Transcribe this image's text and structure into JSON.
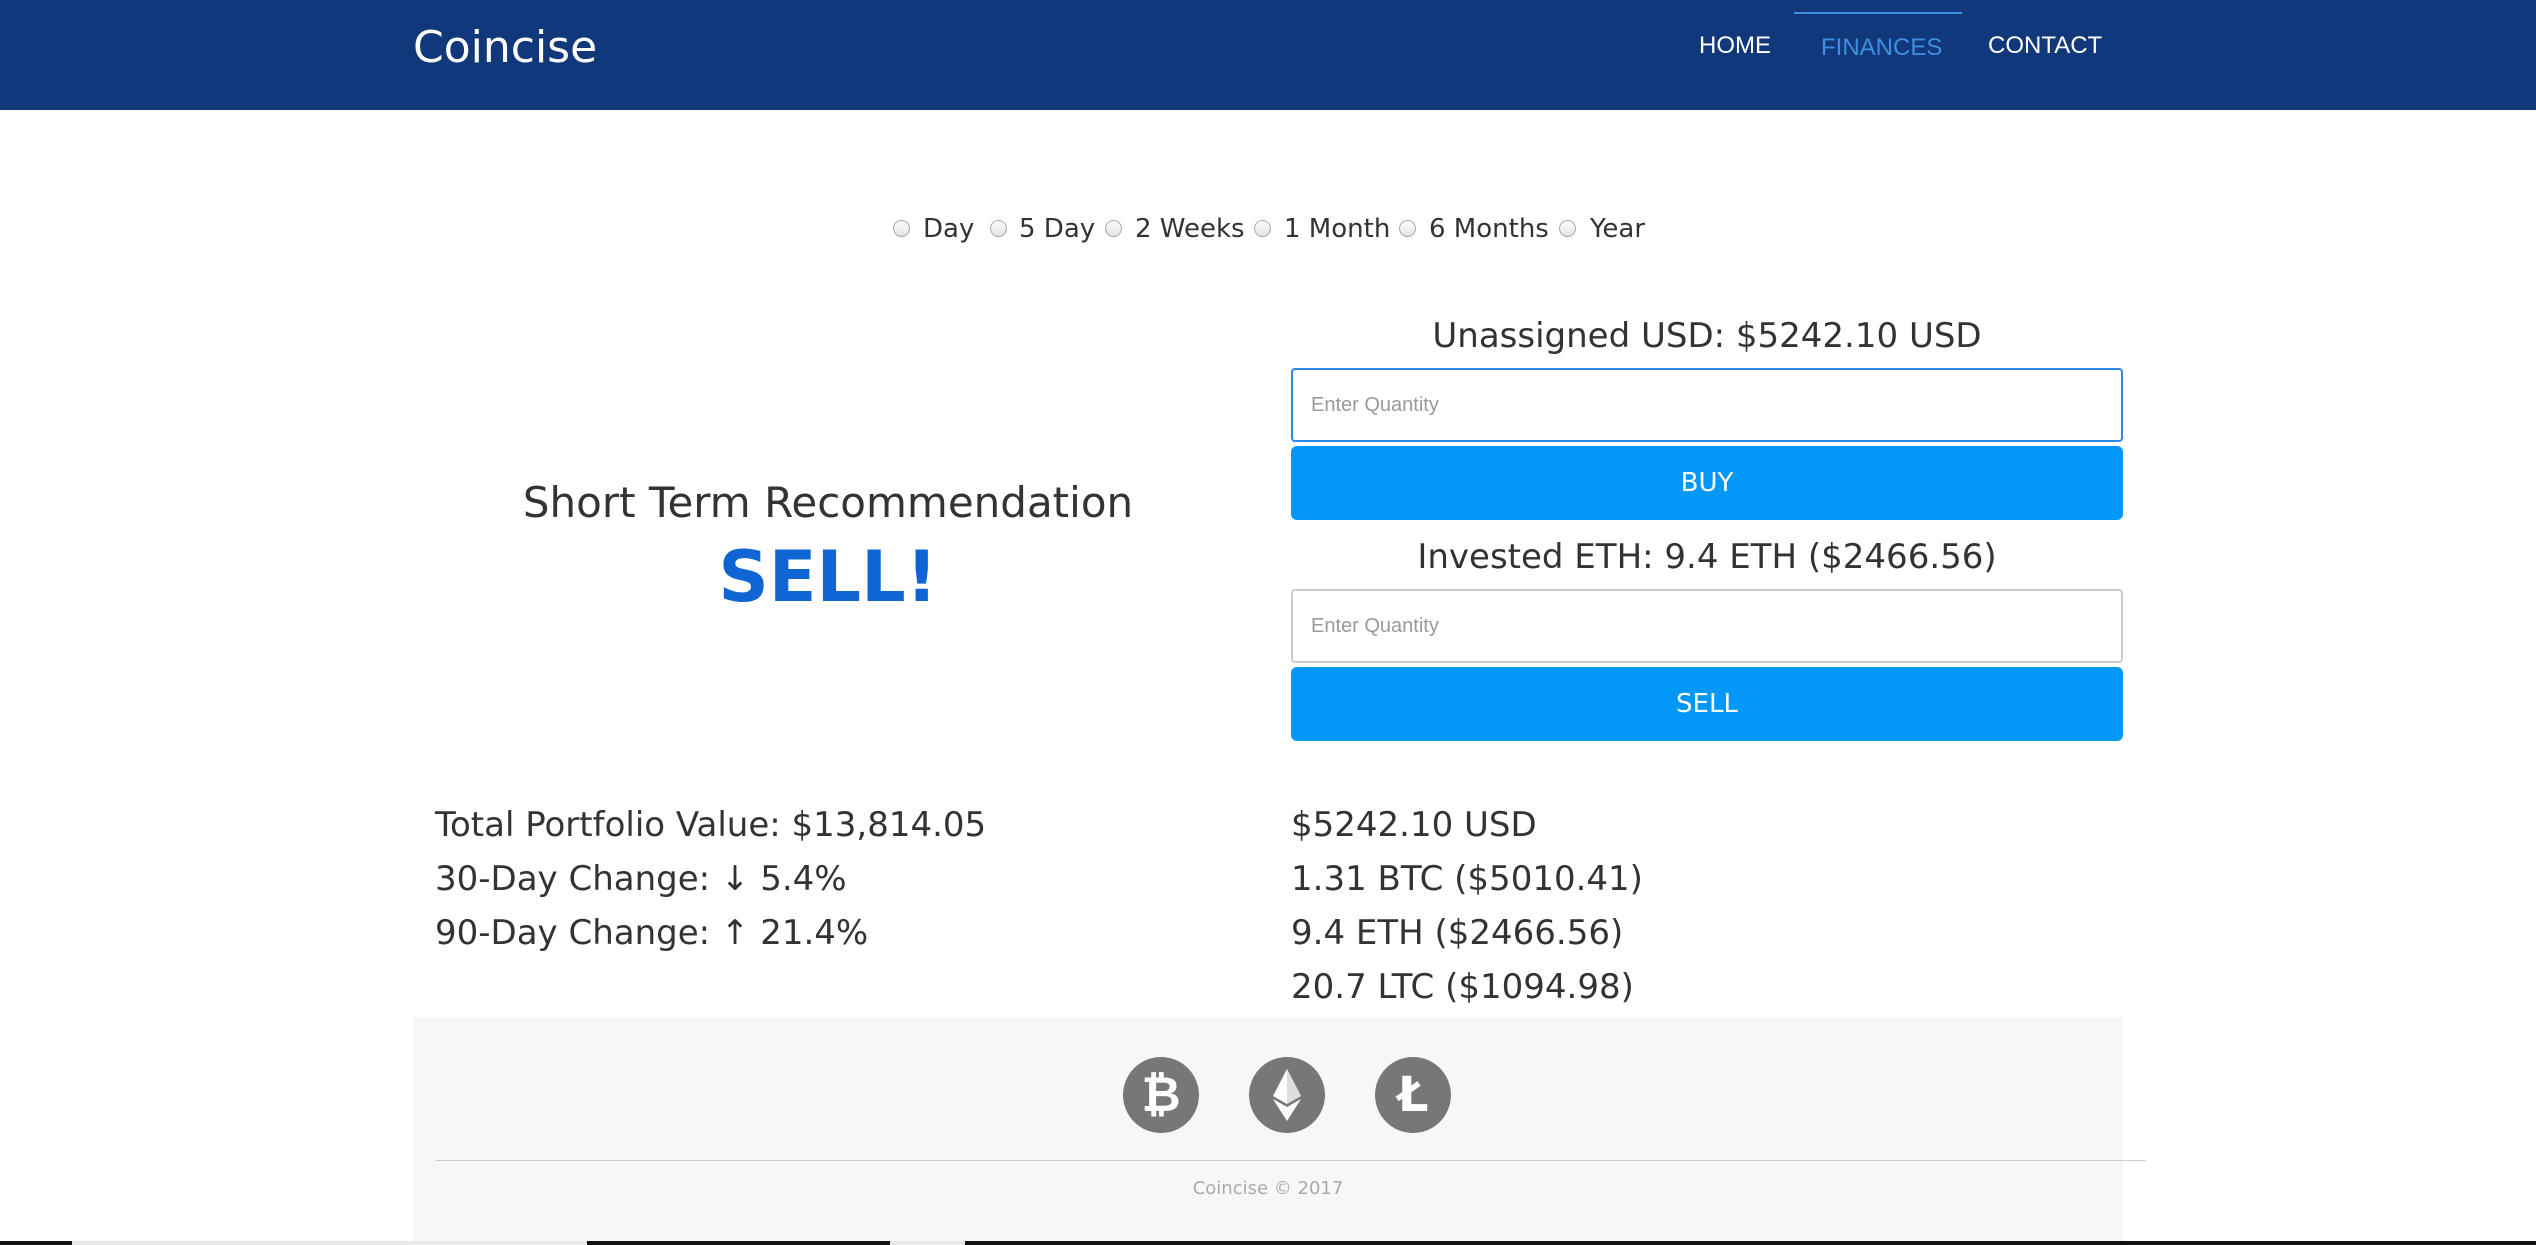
{
  "navbar": {
    "brand": "Coincise",
    "items": [
      {
        "label": "HOME",
        "active": false
      },
      {
        "label": "FINANCES",
        "active": true
      },
      {
        "label": "CONTACT",
        "active": false
      }
    ],
    "background_color": "#10387a",
    "active_color": "#3e8fe0"
  },
  "range_options": [
    "Day",
    "5 Day",
    "2 Weeks",
    "1 Month",
    "6 Months",
    "Year"
  ],
  "recommendation": {
    "title": "Short Term Recommendation",
    "value": "SELL!",
    "value_color": "#1065d4"
  },
  "trade": {
    "buy": {
      "heading": "Unassigned USD: $5242.10 USD",
      "placeholder": "Enter Quantity",
      "button_label": "BUY"
    },
    "sell": {
      "heading": "Invested ETH: 9.4 ETH ($2466.56)",
      "placeholder": "Enter Quantity",
      "button_label": "SELL"
    },
    "button_color": "#0397f8"
  },
  "portfolio": {
    "total": "Total Portfolio Value: $13,814.05",
    "change_30": "30-Day Change: ↓ 5.4%",
    "change_90": "90-Day Change: ↑ 21.4%"
  },
  "holdings": [
    "$5242.10 USD",
    "1.31 BTC ($5010.41)",
    "9.4 ETH ($2466.56)",
    "20.7 LTC ($1094.98)"
  ],
  "footer": {
    "coins": [
      "bitcoin-icon",
      "ethereum-icon",
      "litecoin-icon"
    ],
    "copyright": "Coincise © 2017"
  }
}
